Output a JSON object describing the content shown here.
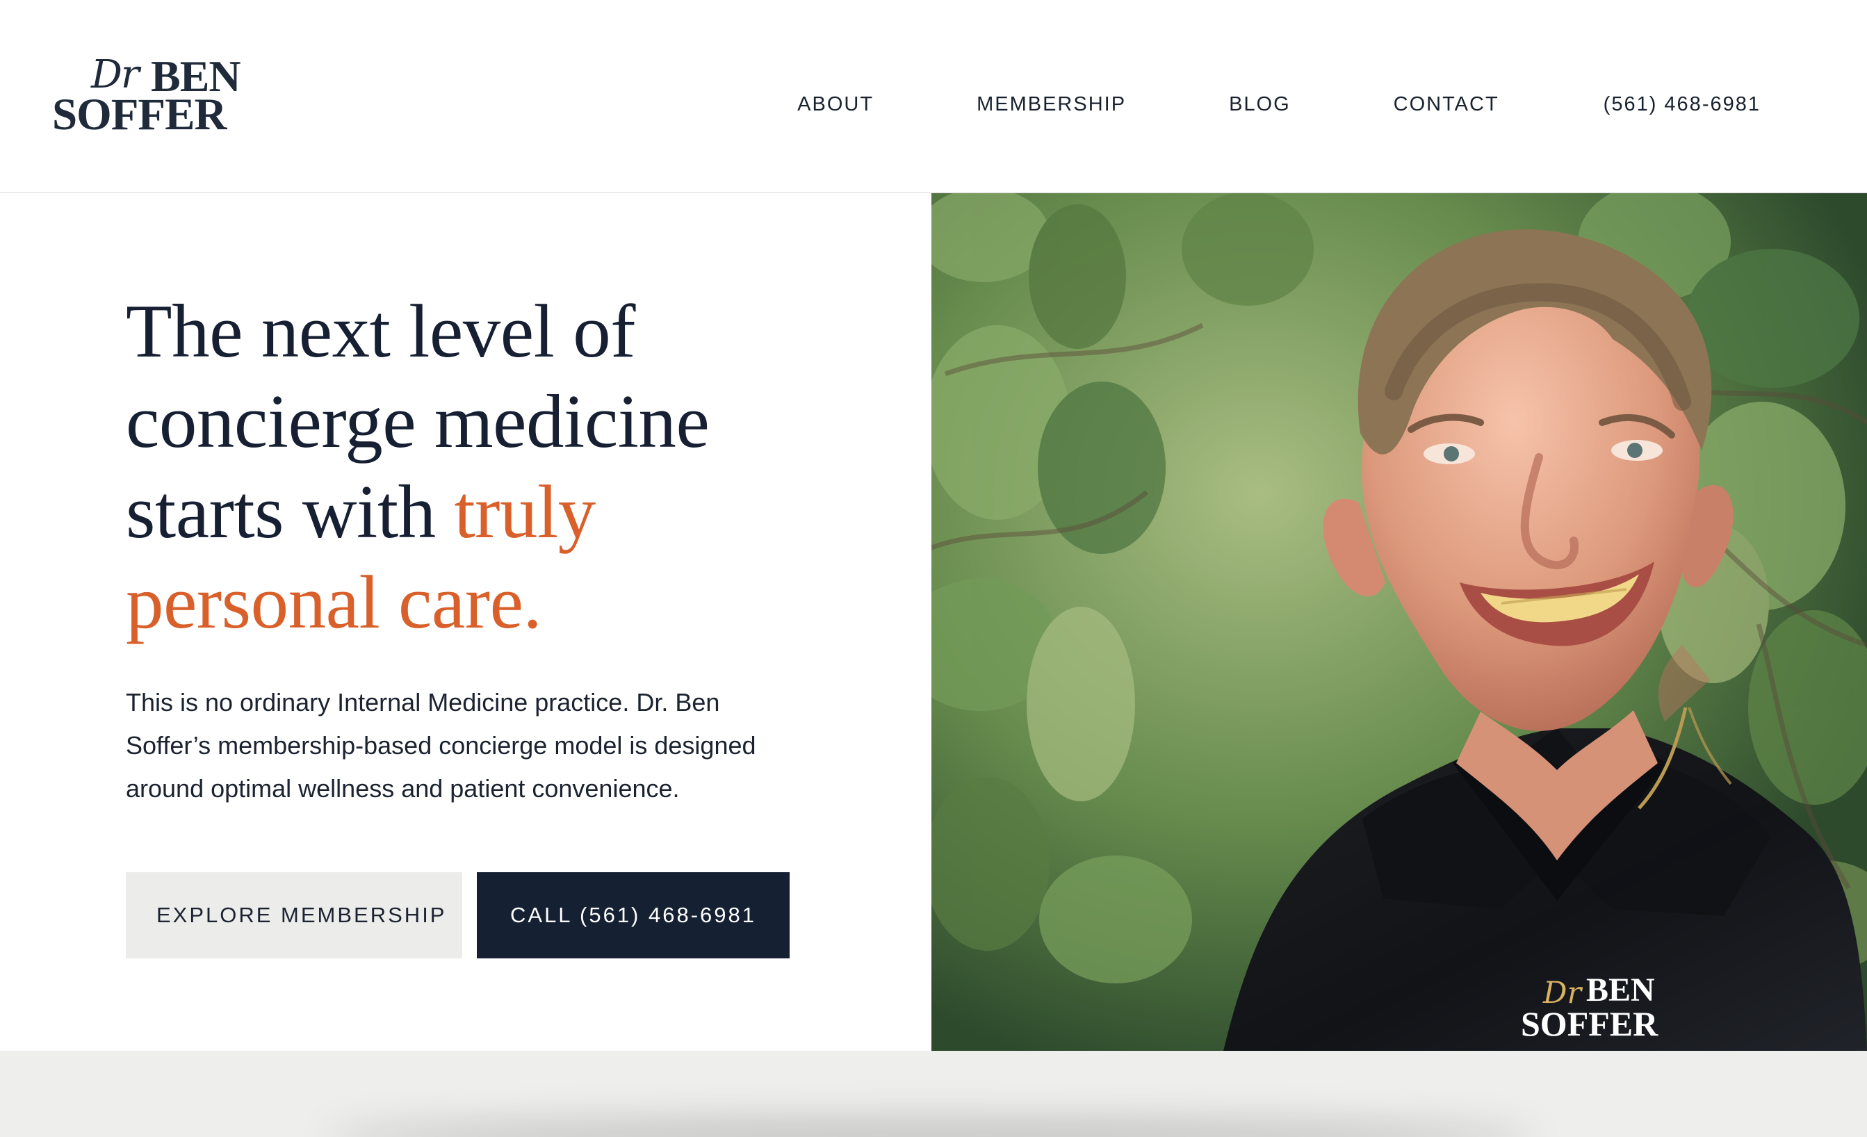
{
  "brand": {
    "dr": "Dr",
    "first": "BEN",
    "last": "SOFFER"
  },
  "nav": {
    "about": "ABOUT",
    "membership": "MEMBERSHIP",
    "blog": "BLOG",
    "contact": "CONTACT",
    "phone": "(561) 468-6981"
  },
  "hero": {
    "headline_main": "The next level of concierge medicine starts with ",
    "headline_accent": "truly personal care.",
    "body": "This is no ordinary Internal Medicine practice. Dr. Ben Soffer’s membership-based concierge model is designed around optimal wellness and patient convenience.",
    "primary_cta": "CALL (561) 468-6981",
    "secondary_cta": "EXPLORE MEMBERSHIP"
  },
  "photo": {
    "shirt_logo_dr": "Dr",
    "shirt_logo_first": "BEN",
    "shirt_logo_last": "SOFFER"
  },
  "colors": {
    "navy": "#152033",
    "accent_orange": "#d9602b",
    "light_gray": "#ececeb"
  }
}
